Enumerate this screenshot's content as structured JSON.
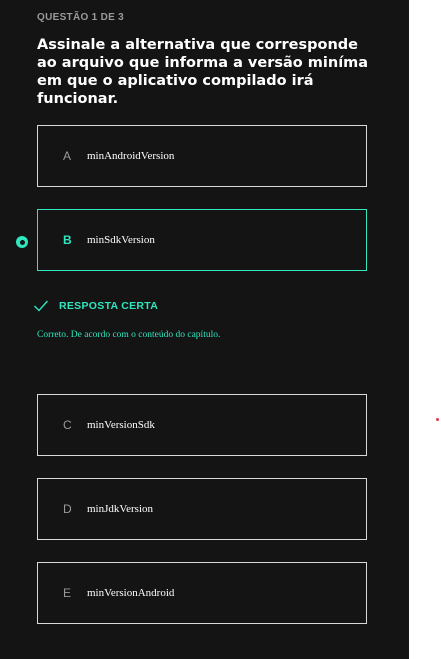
{
  "question": {
    "counter": "QUESTÃO 1 DE 3",
    "text": "Assinale a alternativa que corresponde ao arquivo que informa a versão miníma em que o aplicativo compilado irá funcionar."
  },
  "options": [
    {
      "letter": "A",
      "text": "minAndroidVersion",
      "selected": false
    },
    {
      "letter": "B",
      "text": "minSdkVersion",
      "selected": true
    },
    {
      "letter": "C",
      "text": "minVersionSdk",
      "selected": false
    },
    {
      "letter": "D",
      "text": "minJdkVersion",
      "selected": false
    },
    {
      "letter": "E",
      "text": "minVersionAndroid",
      "selected": false
    }
  ],
  "feedback": {
    "title": "RESPOSTA CERTA",
    "text": "Correto. De acordo com o conteúdo do capítulo.",
    "icon": "check-icon"
  },
  "colors": {
    "panel_bg": "#141414",
    "accent": "#2fe6be",
    "border": "#d8d8d8",
    "muted": "#9a9a9a",
    "marker": "#e8364b"
  }
}
